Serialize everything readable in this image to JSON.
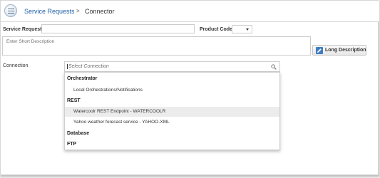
{
  "header": {
    "breadcrumb_link": "Service Requests",
    "breadcrumb_separator": ">",
    "breadcrumb_current": "Connector",
    "app_icon": "menu-circle-icon"
  },
  "form": {
    "service_request_label": "Service Request",
    "service_request_value": "",
    "product_code_label": "Product Code",
    "product_code_value": "",
    "short_description_placeholder": "Enter Short Description",
    "long_description_button": "Long Description",
    "connection_label": "Connection",
    "connection_placeholder": "Select Connection"
  },
  "dropdown": {
    "groups": [
      {
        "label": "Orchestrator",
        "items": [
          "Local Orchestrations/Notifications"
        ]
      },
      {
        "label": "REST",
        "items": [
          "Watercoolr REST Endpoint - WATERCOOLR",
          "Yahoo weather forecast service - YAHOO-XML"
        ]
      },
      {
        "label": "Database",
        "items": []
      },
      {
        "label": "FTP",
        "items": []
      }
    ],
    "highlighted_item": "Watercoolr REST Endpoint - WATERCOOLR"
  },
  "colors": {
    "link": "#1f5fa8",
    "accent_button": "#3f7dc4",
    "highlight_row": "#ececec"
  }
}
